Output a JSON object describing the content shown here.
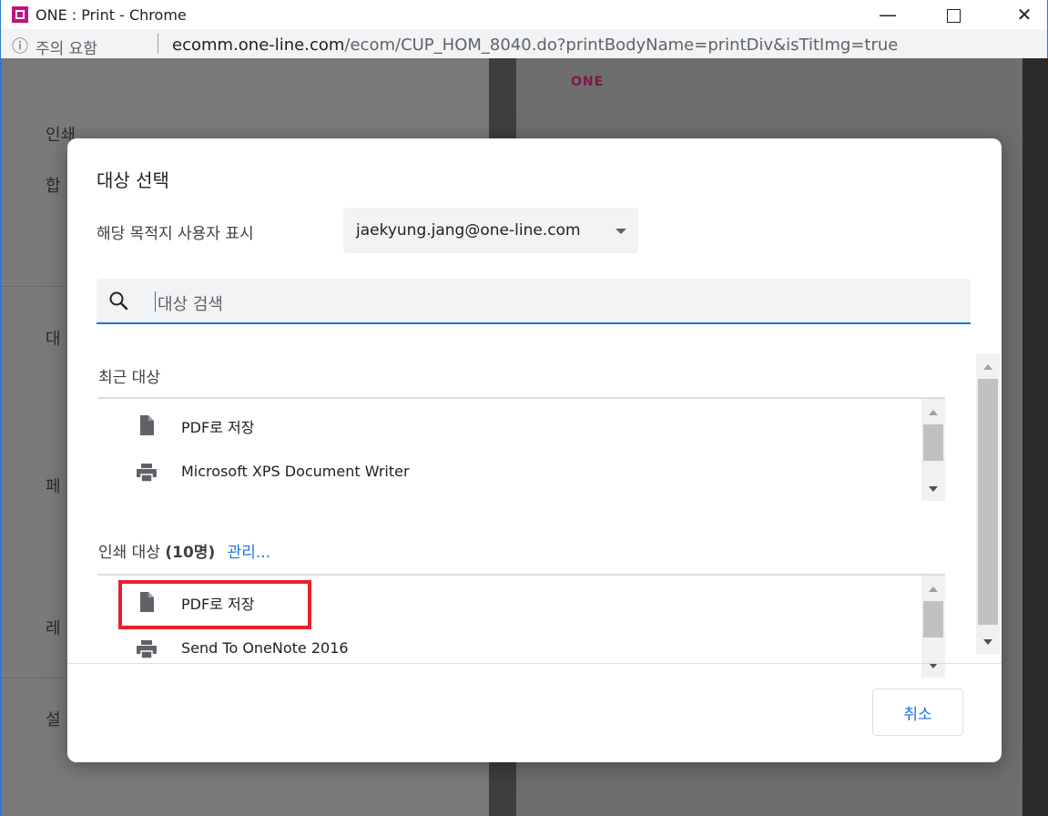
{
  "window": {
    "title": "ONE : Print - Chrome",
    "minimize_glyph": "—",
    "close_glyph": "✕"
  },
  "address_bar": {
    "info_glyph": "ⓘ",
    "security_label": "주의 요함",
    "url_host": "ecomm.one-line.com",
    "url_path": "/ecom/CUP_HOM_8040.do?printBodyName=printDiv&isTitImg=true"
  },
  "background": {
    "sidebar_labels": [
      "인쇄",
      "합",
      "대",
      "페",
      "레",
      "설"
    ],
    "preview_logo": "ONE"
  },
  "dialog": {
    "title": "대상 선택",
    "destination_label": "해당 목적지 사용자 표시",
    "account": "jaekyung.jang@one-line.com",
    "search_placeholder": "대상 검색",
    "recent": {
      "title": "최근 대상",
      "items": [
        {
          "label": "PDF로 저장",
          "icon": "file-icon"
        },
        {
          "label": "Microsoft XPS Document Writer",
          "icon": "printer-icon"
        }
      ]
    },
    "printers": {
      "title": "인쇄 대상",
      "count": "(10명)",
      "manage_link": "관리...",
      "items": [
        {
          "label": "PDF로 저장",
          "icon": "file-icon"
        },
        {
          "label": "Send To OneNote 2016",
          "icon": "printer-icon"
        }
      ]
    },
    "cancel_label": "취소"
  },
  "colors": {
    "accent": "#1a73e8",
    "highlight": "#e8202e",
    "app_icon": "#c0147a"
  }
}
